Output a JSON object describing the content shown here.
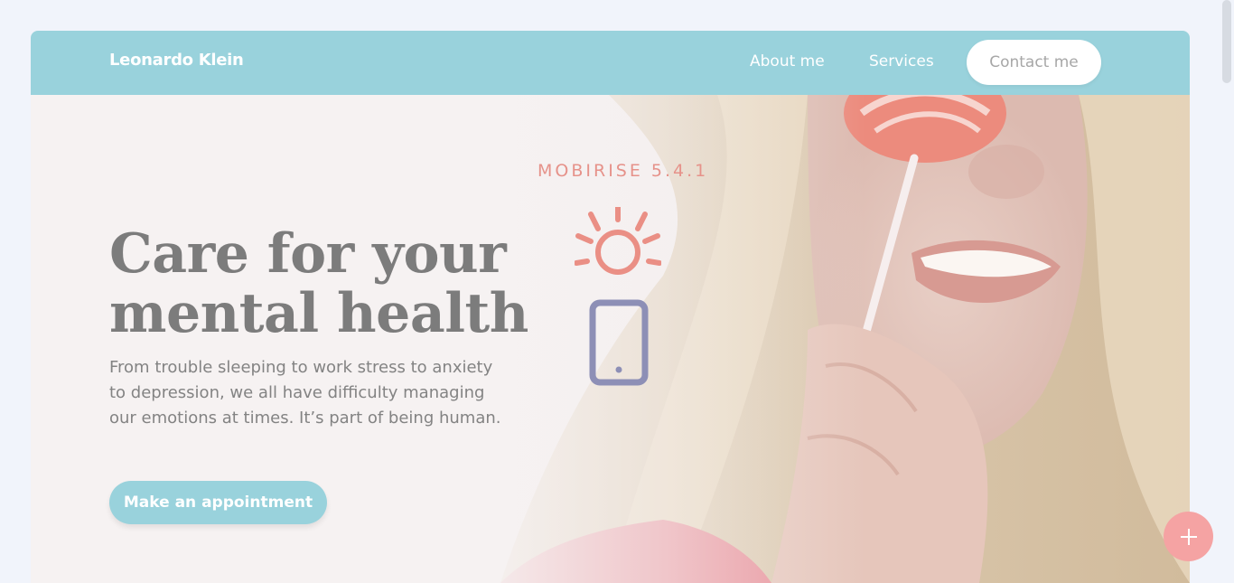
{
  "navbar": {
    "brand": "Leonardo Klein",
    "links": [
      {
        "label": "About me"
      },
      {
        "label": "Services"
      }
    ],
    "contact_label": "Contact me"
  },
  "hero": {
    "badge": "MOBIRISE  5.4.1",
    "title_line1": "Care for your",
    "title_line2": "mental health",
    "text": "From trouble sleeping to work stress to anxiety to depression, we all have difficulty managing our emotions at times. It’s part of being human.",
    "cta_label": "Make an appointment"
  },
  "fab": {
    "icon": "plus-icon"
  },
  "colors": {
    "accent": "#99d2dc",
    "fab": "#f5a3a3",
    "badge": "#e6928a",
    "title": "#7c7c7c"
  }
}
